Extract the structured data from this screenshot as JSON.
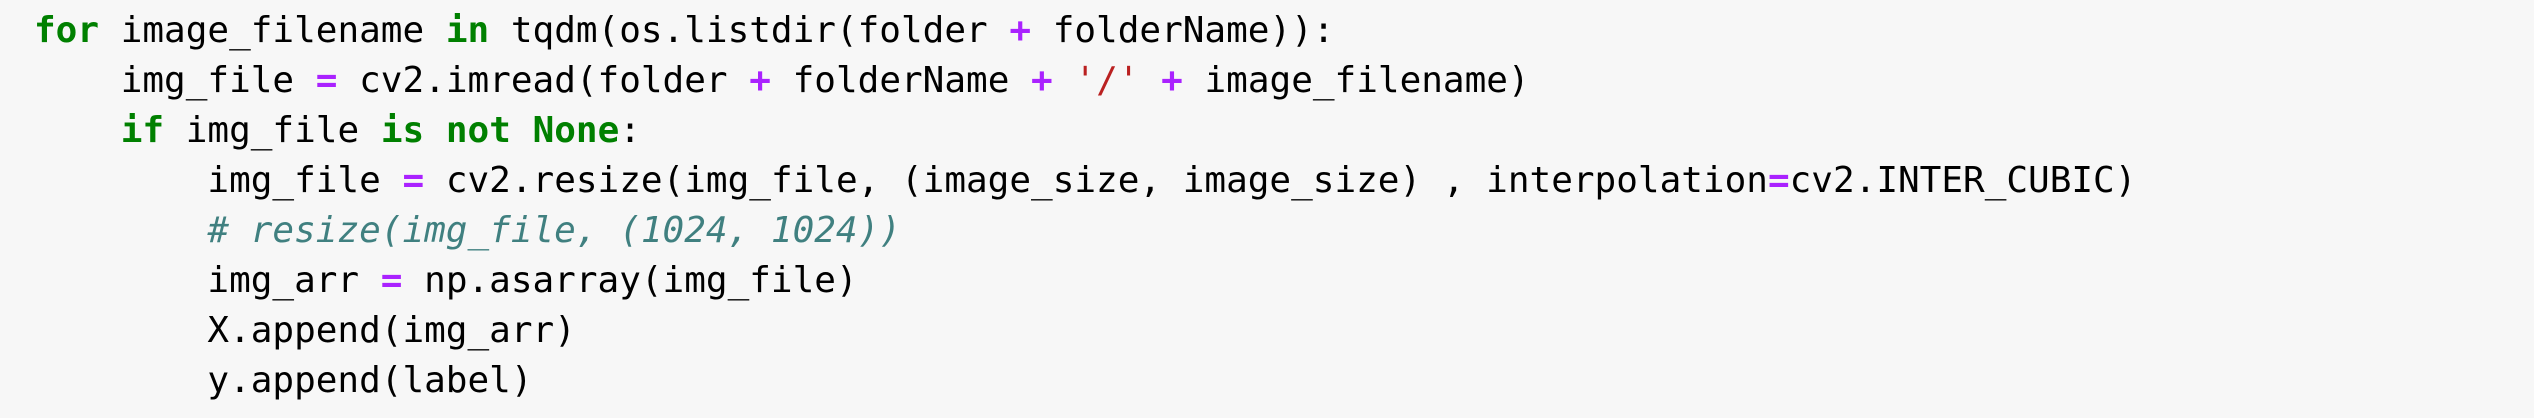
{
  "code_lines": [
    [
      {
        "t": "for",
        "c": "kw"
      },
      {
        "t": " image_filename ",
        "c": "plain"
      },
      {
        "t": "in",
        "c": "kw"
      },
      {
        "t": " tqdm(os.listdir(folder ",
        "c": "plain"
      },
      {
        "t": "+",
        "c": "op"
      },
      {
        "t": " folderName)):",
        "c": "plain"
      }
    ],
    [
      {
        "t": "    img_file ",
        "c": "plain"
      },
      {
        "t": "=",
        "c": "op"
      },
      {
        "t": " cv2.imread(folder ",
        "c": "plain"
      },
      {
        "t": "+",
        "c": "op"
      },
      {
        "t": " folderName ",
        "c": "plain"
      },
      {
        "t": "+",
        "c": "op"
      },
      {
        "t": " ",
        "c": "plain"
      },
      {
        "t": "'/'",
        "c": "str"
      },
      {
        "t": " ",
        "c": "plain"
      },
      {
        "t": "+",
        "c": "op"
      },
      {
        "t": " image_filename)",
        "c": "plain"
      }
    ],
    [
      {
        "t": "    ",
        "c": "plain"
      },
      {
        "t": "if",
        "c": "kw"
      },
      {
        "t": " img_file ",
        "c": "plain"
      },
      {
        "t": "is",
        "c": "kw"
      },
      {
        "t": " ",
        "c": "plain"
      },
      {
        "t": "not",
        "c": "kw"
      },
      {
        "t": " ",
        "c": "plain"
      },
      {
        "t": "None",
        "c": "kw"
      },
      {
        "t": ":",
        "c": "plain"
      }
    ],
    [
      {
        "t": "        img_file ",
        "c": "plain"
      },
      {
        "t": "=",
        "c": "op"
      },
      {
        "t": " cv2.resize(img_file, (image_size, image_size) , interpolation",
        "c": "plain"
      },
      {
        "t": "=",
        "c": "op"
      },
      {
        "t": "cv2.INTER_CUBIC)",
        "c": "plain"
      }
    ],
    [
      {
        "t": "        ",
        "c": "plain"
      },
      {
        "t": "# resize(img_file, (1024, 1024))",
        "c": "cm"
      }
    ],
    [
      {
        "t": "        img_arr ",
        "c": "plain"
      },
      {
        "t": "=",
        "c": "op"
      },
      {
        "t": " np.asarray(img_file)",
        "c": "plain"
      }
    ],
    [
      {
        "t": "        X.append(img_arr)",
        "c": "plain"
      }
    ],
    [
      {
        "t": "        y.append(label)",
        "c": "plain"
      }
    ]
  ],
  "colors": {
    "background": "#f7f7f7",
    "keyword": "#008000",
    "operator": "#aa22ff",
    "string": "#ba2121",
    "comment": "#408080",
    "text": "#000000"
  }
}
